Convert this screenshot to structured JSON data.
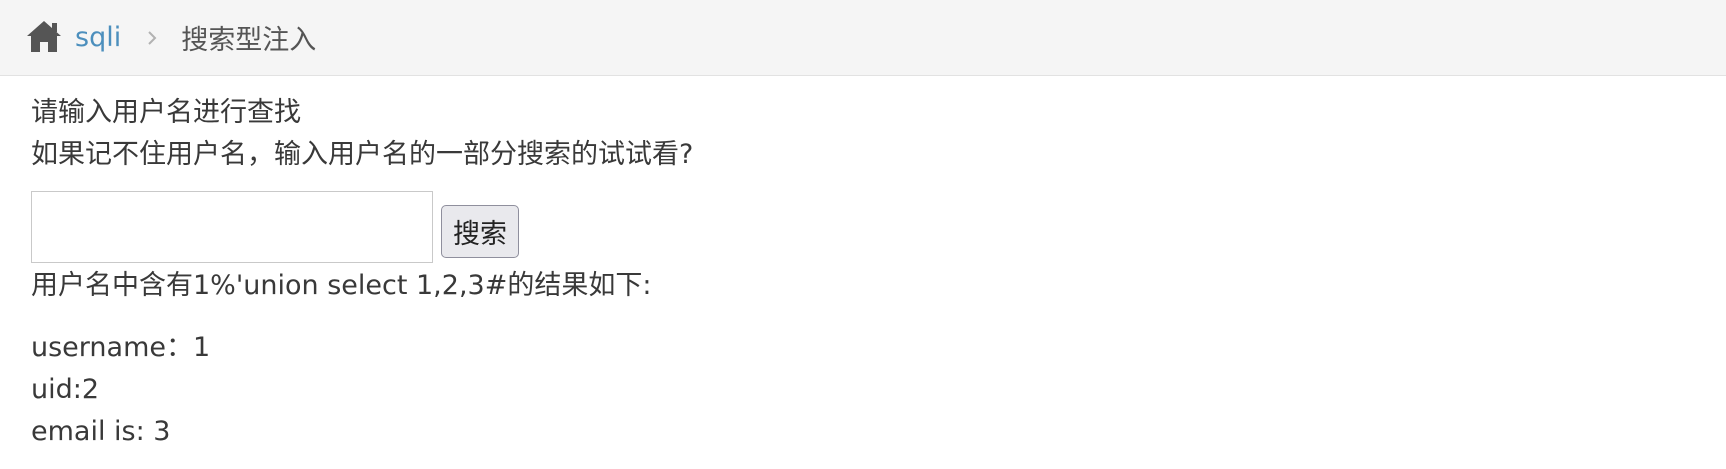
{
  "breadcrumb": {
    "home_icon": "home-icon",
    "link_label": "sqli",
    "separator_icon": "chevron-right-icon",
    "active_label": "搜索型注入"
  },
  "main": {
    "instruction_1": "请输入用户名进行查找",
    "instruction_2": "如果记不住用户名，输入用户名的一部分搜索的试试看?",
    "search": {
      "value": "",
      "placeholder": "",
      "button_label": "搜索"
    },
    "result_summary": "用户名中含有1%'union select 1,2,3#的结果如下:",
    "results": {
      "username_line": "username：1",
      "uid_line": "uid:2",
      "email_line": "email is: 3"
    }
  },
  "colors": {
    "link": "#4c8fbd",
    "breadcrumb_bg": "#f5f5f5",
    "text": "#393939"
  }
}
